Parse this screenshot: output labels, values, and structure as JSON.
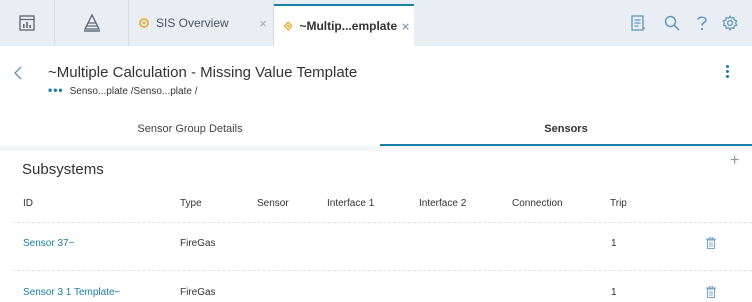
{
  "tabs": [
    {
      "label": "SIS Overview",
      "close": "×"
    },
    {
      "label": "~Multip...emplate",
      "close": "×"
    }
  ],
  "icons": {
    "dashboard": "dashboard-icon",
    "pyramid": "pyramid-icon",
    "notes": "notes-icon",
    "search": "search-icon",
    "help": "help-icon",
    "settings": "gear-icon"
  },
  "colors": {
    "accent": "#1a7da8",
    "tab_icon": "#f2a81d",
    "tab_bar": "#e8eef4"
  },
  "page": {
    "title": "~Multiple Calculation - Missing Value Template",
    "breadcrumb_dots": "•••",
    "breadcrumb": "Senso...plate /Senso...plate /"
  },
  "subtabs": [
    "Sensor Group Details",
    "Sensors"
  ],
  "section": {
    "title": "Subsystems",
    "add": "+"
  },
  "table": {
    "columns": [
      "ID",
      "Type",
      "Sensor",
      "Interface 1",
      "Interface 2",
      "Connection",
      "Trip"
    ],
    "rows": [
      {
        "id": "Sensor 37~",
        "type": "FireGas",
        "sensor": "",
        "iface1": "",
        "iface2": "",
        "connection": "",
        "trip": "1"
      },
      {
        "id": "Sensor 3 1 Template~",
        "type": "FireGas",
        "sensor": "",
        "iface1": "",
        "iface2": "",
        "connection": "",
        "trip": "1"
      }
    ]
  }
}
